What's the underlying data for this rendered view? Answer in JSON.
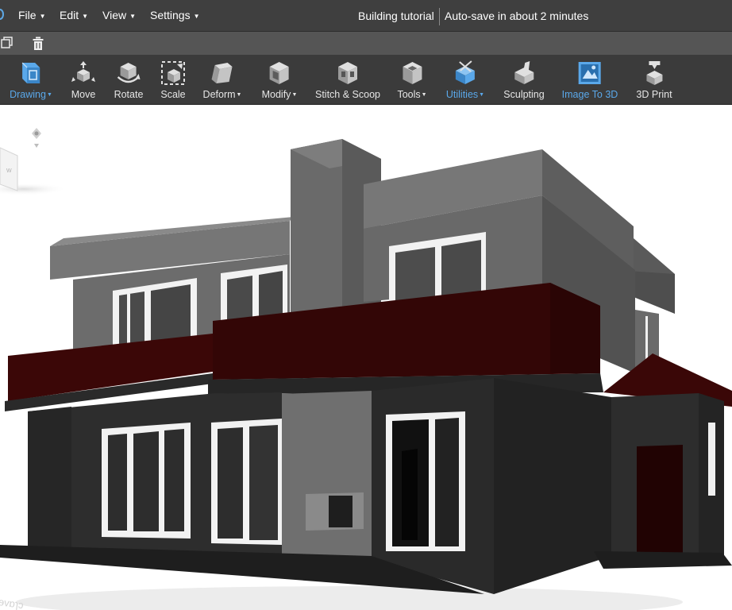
{
  "menubar": {
    "menus": [
      {
        "label": "File"
      },
      {
        "label": "Edit"
      },
      {
        "label": "View"
      },
      {
        "label": "Settings"
      }
    ],
    "document_title": "Building tutorial",
    "autosave_status": "Auto-save in about 2 minutes"
  },
  "quickbar": {
    "icons": [
      "copy-icon",
      "trash-icon"
    ]
  },
  "toolbar": {
    "tools": [
      {
        "label": "Drawing",
        "icon": "drawing-icon",
        "active": true,
        "dropdown": true
      },
      {
        "label": "Move",
        "icon": "move-icon",
        "active": false,
        "dropdown": false
      },
      {
        "label": "Rotate",
        "icon": "rotate-icon",
        "active": false,
        "dropdown": false
      },
      {
        "label": "Scale",
        "icon": "scale-icon",
        "active": false,
        "dropdown": false
      },
      {
        "label": "Deform",
        "icon": "deform-icon",
        "active": false,
        "dropdown": true
      },
      {
        "label": "Modify",
        "icon": "modify-icon",
        "active": false,
        "dropdown": true
      },
      {
        "label": "Stitch & Scoop",
        "icon": "stitch-scoop-icon",
        "active": false,
        "dropdown": false
      },
      {
        "label": "Tools",
        "icon": "tools-icon",
        "active": false,
        "dropdown": true
      },
      {
        "label": "Utilities",
        "icon": "utilities-icon",
        "active": true,
        "dropdown": true
      },
      {
        "label": "Sculpting",
        "icon": "sculpting-icon",
        "active": false,
        "dropdown": false
      },
      {
        "label": "Image To 3D",
        "icon": "image-to-3d-icon",
        "active": true,
        "dropdown": false
      },
      {
        "label": "3D Print",
        "icon": "3d-print-icon",
        "active": false,
        "dropdown": false
      }
    ]
  },
  "viewport": {
    "model": "two-story house model",
    "view_cube_label": "W"
  },
  "colors": {
    "menubar_bg": "#3f3f3f",
    "quickbar_bg": "#555555",
    "toolbar_bg": "#3b3b3b",
    "accent_blue": "#5aa8ea",
    "wall_dark": "#2b2b2b",
    "wall_grey": "#6e6e6e",
    "balcony_maroon": "#3a0606",
    "window_frame": "#f2f2f2"
  }
}
